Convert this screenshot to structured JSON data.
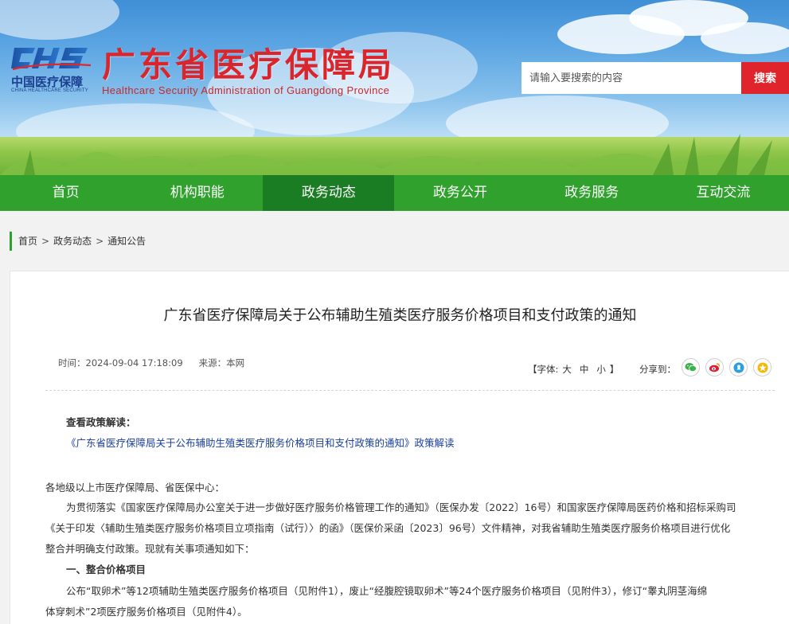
{
  "header": {
    "logo_mark": "CHS",
    "logo_cn": "中国医疗保障",
    "logo_en": "CHINA HEALTHCARE SECURITY",
    "title": "广东省医疗保障局",
    "subtitle": "Healthcare Security Administration of Guangdong Province",
    "search_placeholder": "请输入要搜索的内容",
    "search_button": "搜索"
  },
  "nav": {
    "items": [
      "首页",
      "机构职能",
      "政务动态",
      "政务公开",
      "政务服务",
      "互动交流"
    ],
    "active": "政务动态"
  },
  "breadcrumb": {
    "items": [
      "首页",
      "政务动态",
      "通知公告"
    ],
    "separator": ">"
  },
  "article": {
    "title": "广东省医疗保障局关于公布辅助生殖类医疗服务价格项目和支付政策的通知",
    "time": "时间：2024-09-04 17:18:09",
    "source": "来源：本网",
    "font_size_label": "【字体:",
    "font_sizes": [
      "大",
      "中",
      "小"
    ],
    "font_size_close": "】",
    "share_label": "分享到：",
    "share_icons": [
      "wechat-icon",
      "weibo-icon",
      "qq-icon",
      "qzone-icon"
    ],
    "interpretation_heading": "查看政策解读：",
    "interpretation_link": "《广东省医疗保障局关于公布辅助生殖类医疗服务价格项目和支付政策的通知》政策解读",
    "salutation": "各地级以上市医疗保障局、省医保中心：",
    "para1_line1": "为贯彻落实《国家医疗保障局办公室关于进一步做好医疗服务价格管理工作的通知》（医保办发〔2022〕16号）和国家医疗保障局医药价格和招标采购司",
    "para1_line2": "《关于印发〈辅助生殖类医疗服务价格项目立项指南（试行）〉的函》（医保价采函〔2023〕96号）文件精神，对我省辅助生殖类医疗服务价格项目进行优化",
    "para1_line3": "整合并明确支付政策。现就有关事项通知如下：",
    "section1_heading": "一、整合价格项目",
    "para2_line1": "公布“取卵术”等12项辅助生殖类医疗服务价格项目（见附件1），废止“经腹腔镜取卵术”等24个医疗服务价格项目（见附件3），修订“睾丸阴茎海绵",
    "para2_line2": "体穿刺术”2项医疗服务价格项目（见附件4）。"
  },
  "colors": {
    "nav_green": "#2fa12c",
    "nav_active": "#1b7d23",
    "title_red": "#d9252b",
    "search_red": "#e0242b",
    "link_blue": "#1a3f9c"
  }
}
